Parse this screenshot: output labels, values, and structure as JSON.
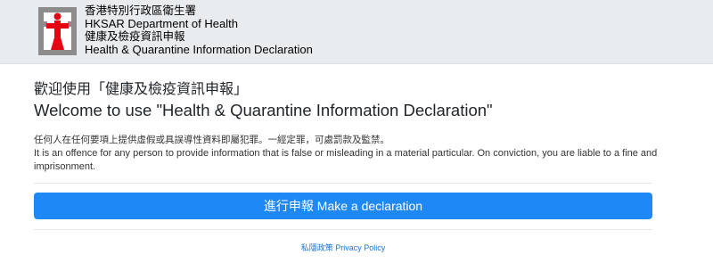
{
  "header": {
    "department_zh": "香港特別行政區衛生署",
    "department_en": "HKSAR Department of Health",
    "app_zh": "健康及檢疫資訊申報",
    "app_en": "Health & Quarantine Information Declaration"
  },
  "welcome": {
    "title_zh": "歡迎使用「健康及檢疫資訊申報」",
    "title_en": "Welcome to use \"Health & Quarantine Information Declaration\""
  },
  "warning": {
    "text_zh": "任何人在任何要項上提供虛假或具誤導性資料即屬犯罪。一經定罪，可處罰款及監禁。",
    "text_en": "It is an offence for any person to provide information that is false or misleading in a material particular. On conviction, you are liable to a fine and imprisonment."
  },
  "actions": {
    "declare_label": "進行申報 Make a declaration",
    "privacy_label": "私隱政策 Privacy Policy"
  },
  "colors": {
    "header_bg": "#e9ecef",
    "primary_button": "#1e88f5",
    "link": "#1a73d9",
    "logo_red": "#e30613",
    "logo_grey": "#8c8c8c"
  }
}
